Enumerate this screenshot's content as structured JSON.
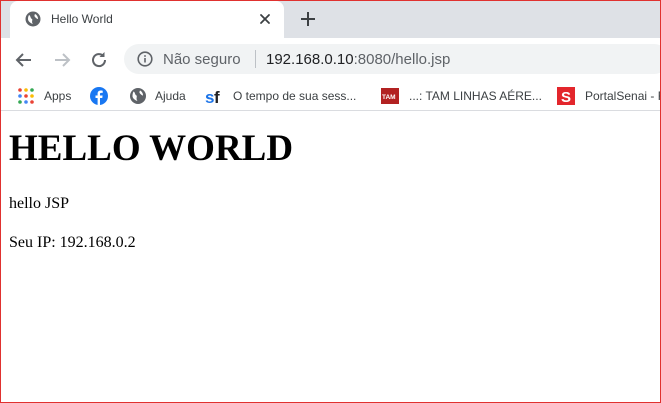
{
  "tab": {
    "title": "Hello World"
  },
  "omnibox": {
    "security_label": "Não seguro",
    "url_host": "192.168.0.10",
    "url_rest": ":8080/hello.jsp"
  },
  "bookmarks": [
    {
      "label": "Apps"
    },
    {
      "label": ""
    },
    {
      "label": "Ajuda"
    },
    {
      "label": "O tempo de sua sess..."
    },
    {
      "label": "...: TAM LINHAS AÉRE..."
    },
    {
      "label": "PortalSenai - F"
    }
  ],
  "page": {
    "heading": "HELLO WORLD",
    "line1": "hello JSP",
    "line2": "Seu IP: 192.168.0.2"
  },
  "colors": {
    "frame_border": "#e0312f",
    "tabstrip": "#dee1e6",
    "omnibox": "#f1f3f4",
    "facebook_blue": "#1877f2",
    "tam_red": "#b22222",
    "senai_red": "#e3262c"
  }
}
